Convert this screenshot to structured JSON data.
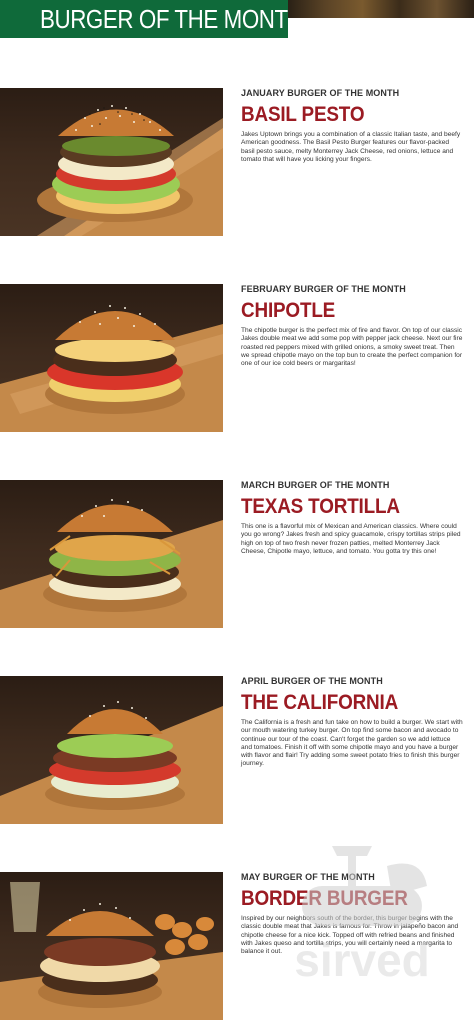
{
  "header": {
    "title": "BURGER OF THE MONTH"
  },
  "burgers": [
    {
      "month": "JANUARY BURGER OF THE MONTH",
      "name": "BASIL PESTO",
      "description": "Jakes Uptown brings you a combination of a classic Italian taste, and beefy American goodness. The Basil Pesto Burger features our flavor-packed basil pesto sauce, melty Monterrey Jack Cheese, red onions, lettuce and tomato that will have you licking your fingers."
    },
    {
      "month": "FEBRUARY BURGER OF THE MONTH",
      "name": "CHIPOTLE",
      "description": "The chipotle burger is the perfect mix of fire and flavor. On top of our classic Jakes double meat we add some pop with pepper jack cheese. Next our fire roasted red peppers mixed with grilled onions, a smoky sweet treat. Then we spread chipotle mayo on the top bun to create the perfect companion for one of our ice cold beers or margaritas!"
    },
    {
      "month": "MARCH BURGER OF THE MONTH",
      "name": "TEXAS TORTILLA",
      "description": "This one is a flavorful mix of Mexican and American classics. Where could you go wrong? Jakes fresh and spicy guacamole, crispy tortillas strips piled high on top of two fresh never frozen patties, melted Monterrey Jack Cheese, Chipotle mayo, lettuce, and tomato. You gotta try this one!"
    },
    {
      "month": "APRIL BURGER OF THE MONTH",
      "name": "THE CALIFORNIA",
      "description": "The California is a fresh and fun take on how to build a burger. We start with our mouth watering turkey burger. On top find some bacon and avocado to continue our tour of the coast. Can't forget the garden so we add lettuce and tomatoes. Finish it off with some chipotle mayo and you have a burger with flavor and flair! Try adding some sweet potato fries to finish this burger journey."
    },
    {
      "month": "MAY BURGER OF THE MONTH",
      "name": "BORDER BURGER",
      "description": "Inspired by our neighbors south of the border, this burger begins with the classic double meat that Jakes is famous for. Throw in jalapeño bacon and chipotle cheese for a nice kick. Topped off with refried beans and finished with Jakes queso and tortilla strips, you will certainly need a margarita to balance it out."
    }
  ],
  "watermark": {
    "text": "sirved"
  },
  "colors": {
    "header_green": "#0f6a3a",
    "name_red": "#9b1b23"
  }
}
